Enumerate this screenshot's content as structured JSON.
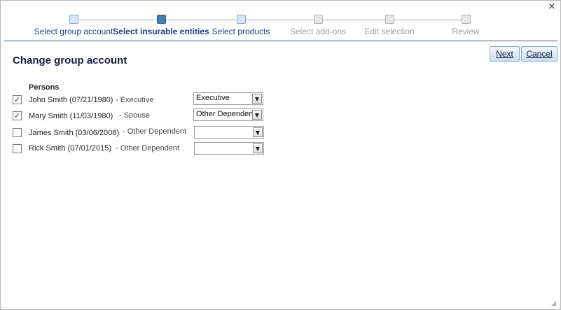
{
  "window": {
    "close_glyph": "×"
  },
  "wizard": {
    "steps": [
      {
        "label": "Select group account",
        "state": "done"
      },
      {
        "label": "Select insurable entities",
        "state": "active"
      },
      {
        "label": "Select products",
        "state": "done"
      },
      {
        "label": "Select add-ons",
        "state": "pending"
      },
      {
        "label": "Edit selection",
        "state": "pending"
      },
      {
        "label": "Review",
        "state": "pending"
      }
    ]
  },
  "page": {
    "title": "Change group account",
    "next_label": "Next",
    "cancel_label": "Cancel",
    "section_label": "Persons"
  },
  "persons": [
    {
      "name": "John Smith (07/21/1980)",
      "role": "- Executive",
      "checked": true,
      "selection": "Executive"
    },
    {
      "name": "Mary Smith (11/03/1980)",
      "role": "- Spouse",
      "checked": true,
      "selection": "Other Dependent"
    },
    {
      "name": "James Smith (03/06/2008)",
      "role": "- Other Dependent",
      "checked": false,
      "selection": ""
    },
    {
      "name": "Rick Smith (07/01/2015)",
      "role": "- Other Dependent",
      "checked": false,
      "selection": ""
    }
  ],
  "icons": {
    "checkmark": "✓",
    "dropdown_arrow": "▼",
    "resize_grip": "◢"
  },
  "colors": {
    "accent": "#3d7fb8",
    "step_done_text": "#1f3f8a",
    "step_pending_text": "#a0a0a0",
    "title_text": "#1a1a40"
  }
}
